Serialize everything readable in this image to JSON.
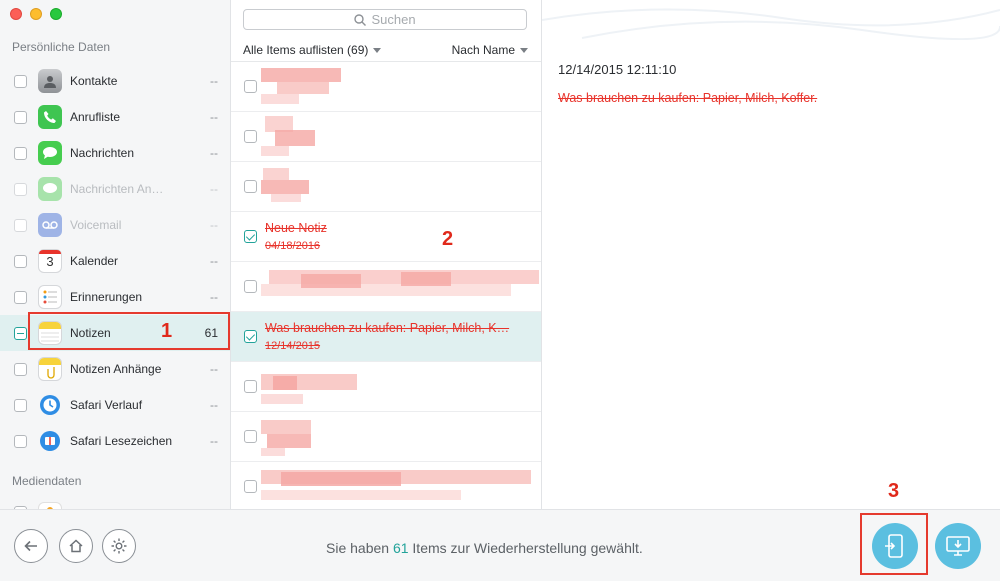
{
  "window": {
    "controls": [
      "close",
      "minimize",
      "maximize"
    ]
  },
  "sidebar": {
    "section_personal": "Persönliche Daten",
    "section_media": "Mediendaten",
    "items": [
      {
        "label": "Kontakte",
        "count": "--",
        "icon": "contacts-icon"
      },
      {
        "label": "Anrufliste",
        "count": "--",
        "icon": "phone-icon"
      },
      {
        "label": "Nachrichten",
        "count": "--",
        "icon": "messages-icon"
      },
      {
        "label": "Nachrichten An…",
        "count": "--",
        "icon": "message-attachments-icon"
      },
      {
        "label": "Voicemail",
        "count": "--",
        "icon": "voicemail-icon"
      },
      {
        "label": "Kalender",
        "count": "--",
        "icon": "calendar-icon",
        "icon_text": "3"
      },
      {
        "label": "Erinnerungen",
        "count": "--",
        "icon": "reminders-icon"
      },
      {
        "label": "Notizen",
        "count": "61",
        "icon": "notes-icon"
      },
      {
        "label": "Notizen Anhänge",
        "count": "--",
        "icon": "notes-attachments-icon"
      },
      {
        "label": "Safari Verlauf",
        "count": "--",
        "icon": "safari-history-icon"
      },
      {
        "label": "Safari Lesezeichen",
        "count": "--",
        "icon": "safari-bookmarks-icon"
      }
    ]
  },
  "annotations": {
    "step1": "1",
    "step2": "2",
    "step3": "3"
  },
  "list": {
    "search_placeholder": "Suchen",
    "filter_label": "Alle Items auflisten (69)",
    "sort_label": "Nach Name",
    "notes": [
      {
        "title": "Neue Notiz",
        "date": "04/18/2016",
        "checked": true
      },
      {
        "title": "Was brauchen zu kaufen: Papier, Milch, K…",
        "date": "12/14/2015",
        "checked": true
      }
    ]
  },
  "detail": {
    "date": "12/14/2015 12:11:10",
    "body": "Was brauchen zu kaufen: Papier, Milch, Koffer."
  },
  "bottom": {
    "status_prefix": "Sie haben",
    "status_count": "61",
    "status_suffix": "Items zur Wiederherstellung gewählt."
  },
  "colors": {
    "accent": "#22a39a",
    "deleted_text": "#e8332b",
    "annotation": "#e0291b",
    "primary_button": "#5bbfe0"
  }
}
